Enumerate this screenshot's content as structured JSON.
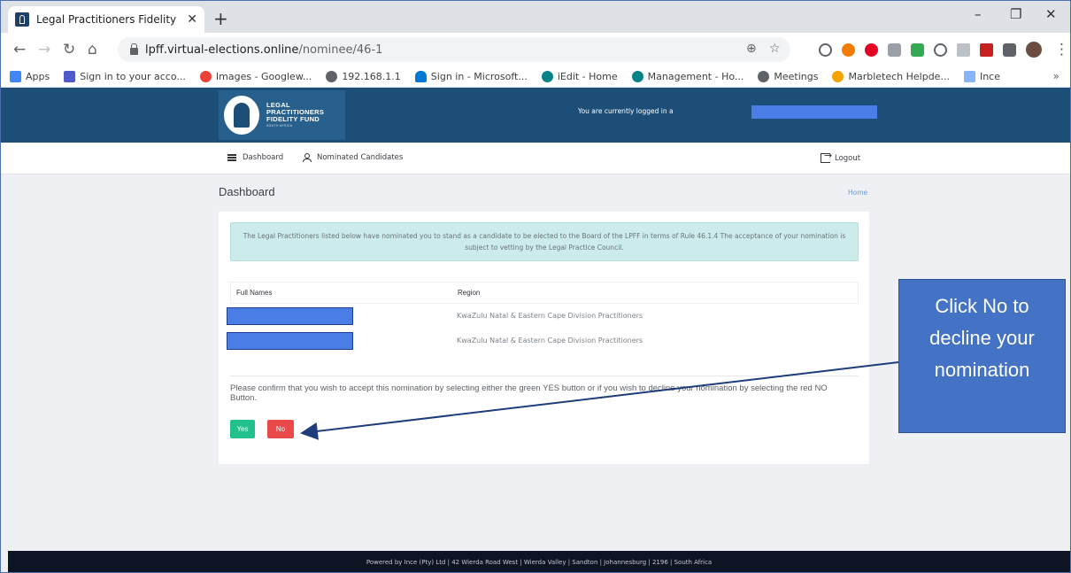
{
  "browser": {
    "tab_title": "Legal Practitioners Fidelity Fund",
    "tab_close": "✕",
    "new_tab": "+",
    "url_host": "lpff.virtual-elections.online",
    "url_path": "/nominee/46-1",
    "window_controls": [
      "–",
      "❐",
      "✕"
    ],
    "bookmarks": [
      {
        "label": "Apps",
        "color": "#4285f4"
      },
      {
        "label": "Sign in to your acco...",
        "color": "#5059c9"
      },
      {
        "label": "Images - Googlew...",
        "color": "#ea4335"
      },
      {
        "label": "192.168.1.1",
        "color": "#5f6368"
      },
      {
        "label": "Sign in - Microsoft...",
        "color": "#0078d4"
      },
      {
        "label": "iEdit - Home",
        "color": "#038387"
      },
      {
        "label": "Management - Ho...",
        "color": "#038387"
      },
      {
        "label": "Meetings",
        "color": "#5f6368"
      },
      {
        "label": "Marbletech Helpde...",
        "color": "#f4a300"
      },
      {
        "label": "Ince",
        "color": "#8ab4f8"
      }
    ],
    "bookmarks_overflow": "»"
  },
  "site": {
    "logo_line1": "LEGAL",
    "logo_line2": "PRACTITIONERS",
    "logo_line3": "FIDELITY FUND",
    "logo_line4": "SOUTH AFRICA",
    "login_status": "You are currently logged in a",
    "nav_dashboard": "Dashboard",
    "nav_candidates": "Nominated Candidates",
    "nav_logout": "Logout",
    "page_title": "Dashboard",
    "breadcrumb_home": "Home"
  },
  "nomination": {
    "alert_text": "The Legal Practitioners listed below have nominated you to stand as a candidate to be elected to the Board of the LPFF in terms of Rule 46.1.4 The acceptance of your nomination is subject to vetting by the Legal Practice Council.",
    "col_full_names": "Full Names",
    "col_region": "Region",
    "rows": [
      {
        "region": "KwaZulu Natal & Eastern Cape Division Practitioners"
      },
      {
        "region": "KwaZulu Natal & Eastern Cape Division Practitioners"
      }
    ],
    "confirm_text": "Please confirm that you wish to accept this nomination by selecting either the green YES button or if you wish to decline your nomination by selecting the red NO Button.",
    "yes_label": "Yes",
    "no_label": "No"
  },
  "footer": {
    "text": "Powered by Ince (Pty) Ltd | 42 Wierda Road West | Wierda Valley | Sandton | Johannesburg | 2196 | South Africa"
  },
  "annotation": {
    "line1": "Click No to",
    "line2": "decline your",
    "line3": "nomination"
  },
  "colors": {
    "header_bg": "#1d4e78",
    "yes_button": "#22c08c",
    "no_button": "#ea4949",
    "callout_bg": "#4472c4",
    "alert_bg": "#ccebeb"
  }
}
